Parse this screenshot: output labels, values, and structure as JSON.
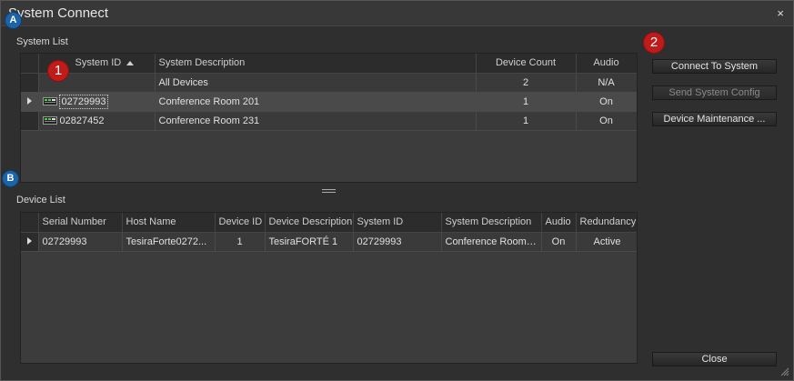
{
  "window": {
    "title": "System Connect",
    "close_glyph": "×"
  },
  "system_list": {
    "label": "System List",
    "columns": {
      "system_id": "System ID",
      "description": "System Description",
      "device_count": "Device Count",
      "audio": "Audio"
    },
    "rows": [
      {
        "system_id": "",
        "description": "All Devices",
        "device_count": "2",
        "audio": "N/A"
      },
      {
        "system_id": "02729993",
        "description": "Conference Room 201",
        "device_count": "1",
        "audio": "On"
      },
      {
        "system_id": "02827452",
        "description": "Conference Room 231",
        "device_count": "1",
        "audio": "On"
      }
    ]
  },
  "device_list": {
    "label": "Device List",
    "columns": {
      "serial": "Serial Number",
      "host": "Host Name",
      "device_id": "Device ID",
      "device_desc": "Device Description",
      "system_id": "System ID",
      "system_desc": "System Description",
      "audio": "Audio",
      "redundancy": "Redundancy"
    },
    "rows": [
      {
        "serial": "02729993",
        "host": "TesiraForte0272...",
        "device_id": "1",
        "device_desc": "TesiraFORTÉ 1",
        "system_id": "02729993",
        "system_desc": "Conference Room ...",
        "audio": "On",
        "redundancy": "Active"
      }
    ]
  },
  "buttons": {
    "connect": "Connect To System",
    "send_config": "Send System Config",
    "maintenance": "Device Maintenance ...",
    "close": "Close"
  },
  "badges": {
    "a": "A",
    "b": "B",
    "one": "1",
    "two": "2"
  },
  "colors": {
    "badge_blue": "#1b64a8",
    "badge_red": "#c01b1b"
  },
  "icons": {
    "device": "device-icon",
    "sort": "sort-ascending-icon",
    "row_pointer": "row-pointer-icon"
  }
}
